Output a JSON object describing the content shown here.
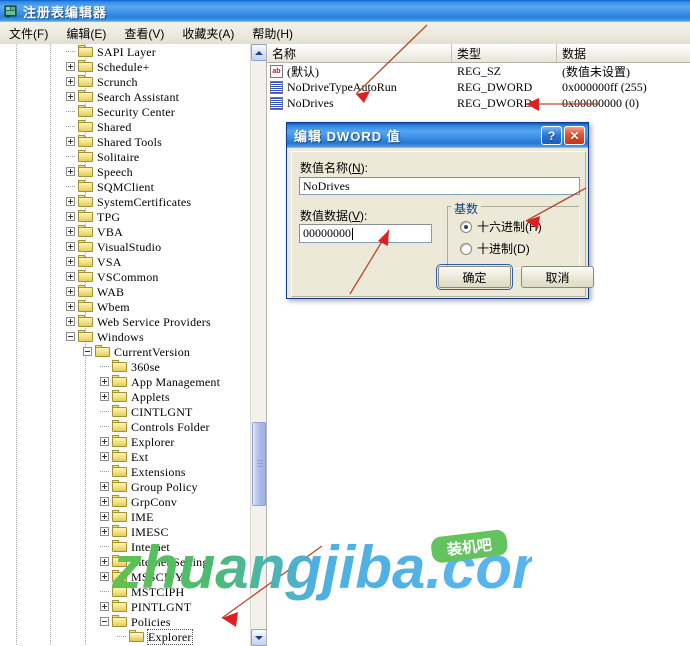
{
  "window": {
    "title": "注册表编辑器",
    "icon": "registry-editor-icon"
  },
  "menu": {
    "items": [
      {
        "label": "文件(F)",
        "text": "文件",
        "mnemonic": "F"
      },
      {
        "label": "编辑(E)",
        "text": "编辑",
        "mnemonic": "E"
      },
      {
        "label": "查看(V)",
        "text": "查看",
        "mnemonic": "V"
      },
      {
        "label": "收藏夹(A)",
        "text": "收藏夹",
        "mnemonic": "A"
      },
      {
        "label": "帮助(H)",
        "text": "帮助",
        "mnemonic": "H"
      }
    ]
  },
  "tree": {
    "nodes": [
      {
        "label": "SAPI Layer",
        "indent": 1,
        "expander": "none"
      },
      {
        "label": "Schedule+",
        "indent": 1,
        "expander": "plus"
      },
      {
        "label": "Scrunch",
        "indent": 1,
        "expander": "plus"
      },
      {
        "label": "Search Assistant",
        "indent": 1,
        "expander": "plus"
      },
      {
        "label": "Security Center",
        "indent": 1,
        "expander": "none"
      },
      {
        "label": "Shared",
        "indent": 1,
        "expander": "none"
      },
      {
        "label": "Shared Tools",
        "indent": 1,
        "expander": "plus"
      },
      {
        "label": "Solitaire",
        "indent": 1,
        "expander": "none"
      },
      {
        "label": "Speech",
        "indent": 1,
        "expander": "plus"
      },
      {
        "label": "SQMClient",
        "indent": 1,
        "expander": "none"
      },
      {
        "label": "SystemCertificates",
        "indent": 1,
        "expander": "plus"
      },
      {
        "label": "TPG",
        "indent": 1,
        "expander": "plus"
      },
      {
        "label": "VBA",
        "indent": 1,
        "expander": "plus"
      },
      {
        "label": "VisualStudio",
        "indent": 1,
        "expander": "plus"
      },
      {
        "label": "VSA",
        "indent": 1,
        "expander": "plus"
      },
      {
        "label": "VSCommon",
        "indent": 1,
        "expander": "plus"
      },
      {
        "label": "WAB",
        "indent": 1,
        "expander": "plus"
      },
      {
        "label": "Wbem",
        "indent": 1,
        "expander": "plus"
      },
      {
        "label": "Web Service Providers",
        "indent": 1,
        "expander": "plus"
      },
      {
        "label": "Windows",
        "indent": 1,
        "expander": "minus"
      },
      {
        "label": "CurrentVersion",
        "indent": 2,
        "expander": "minus"
      },
      {
        "label": "360se",
        "indent": 3,
        "expander": "none"
      },
      {
        "label": "App Management",
        "indent": 3,
        "expander": "plus"
      },
      {
        "label": "Applets",
        "indent": 3,
        "expander": "plus"
      },
      {
        "label": "CINTLGNT",
        "indent": 3,
        "expander": "none"
      },
      {
        "label": "Controls Folder",
        "indent": 3,
        "expander": "none"
      },
      {
        "label": "Explorer",
        "indent": 3,
        "expander": "plus"
      },
      {
        "label": "Ext",
        "indent": 3,
        "expander": "plus"
      },
      {
        "label": "Extensions",
        "indent": 3,
        "expander": "none"
      },
      {
        "label": "Group Policy",
        "indent": 3,
        "expander": "plus"
      },
      {
        "label": "GrpConv",
        "indent": 3,
        "expander": "plus"
      },
      {
        "label": "IME",
        "indent": 3,
        "expander": "plus"
      },
      {
        "label": "IMESC",
        "indent": 3,
        "expander": "plus"
      },
      {
        "label": "Internet",
        "indent": 3,
        "expander": "none"
      },
      {
        "label": "Internet Settings",
        "indent": 3,
        "expander": "plus"
      },
      {
        "label": "MSSCIPY",
        "indent": 3,
        "expander": "plus"
      },
      {
        "label": "MSTCIPH",
        "indent": 3,
        "expander": "none"
      },
      {
        "label": "PINTLGNT",
        "indent": 3,
        "expander": "plus"
      },
      {
        "label": "Policies",
        "indent": 3,
        "expander": "minus"
      },
      {
        "label": "Explorer",
        "indent": 4,
        "expander": "none",
        "selected": true,
        "open": true
      }
    ]
  },
  "list": {
    "columns": [
      "名称",
      "类型",
      "数据"
    ],
    "rows": [
      {
        "icon": "string-value-icon",
        "icon_kind": "sz",
        "icon_text": "ab",
        "name": "(默认)",
        "type": "REG_SZ",
        "data": "(数值未设置)"
      },
      {
        "icon": "dword-value-icon",
        "icon_kind": "dw",
        "icon_text": "",
        "name": "NoDriveTypeAutoRun",
        "type": "REG_DWORD",
        "data": "0x000000ff (255)"
      },
      {
        "icon": "dword-value-icon",
        "icon_kind": "dw",
        "icon_text": "",
        "name": "NoDrives",
        "type": "REG_DWORD",
        "data": "0x00000000 (0)"
      }
    ]
  },
  "dialog": {
    "title": "编辑 DWORD 值",
    "help_button": "?",
    "close_button": "✕",
    "value_name_label": "数值名称(N):",
    "value_name_label_text": "数值名称",
    "value_name_mnemonic": "N",
    "value_name": "NoDrives",
    "value_data_label": "数值数据(V):",
    "value_data_label_text": "数值数据",
    "value_data_mnemonic": "V",
    "value_data": "00000000",
    "base_group_title": "基数",
    "base_options": [
      {
        "label": "十六进制(H)",
        "text": "十六进制",
        "mnemonic": "H",
        "checked": true
      },
      {
        "label": "十进制(D)",
        "text": "十进制",
        "mnemonic": "D",
        "checked": false
      }
    ],
    "ok_label": "确定",
    "cancel_label": "取消"
  },
  "watermark": {
    "text": "zhuangjiba.com",
    "badge": "装机吧",
    "color_green": "#4caf50",
    "color_blue": "#4aa8e8"
  },
  "colors": {
    "titlebar_blue": "#2f84e0",
    "dialog_face": "#ece9d8",
    "annotation_red": "#c0392b",
    "folder_yellow": "#f2e07e"
  }
}
